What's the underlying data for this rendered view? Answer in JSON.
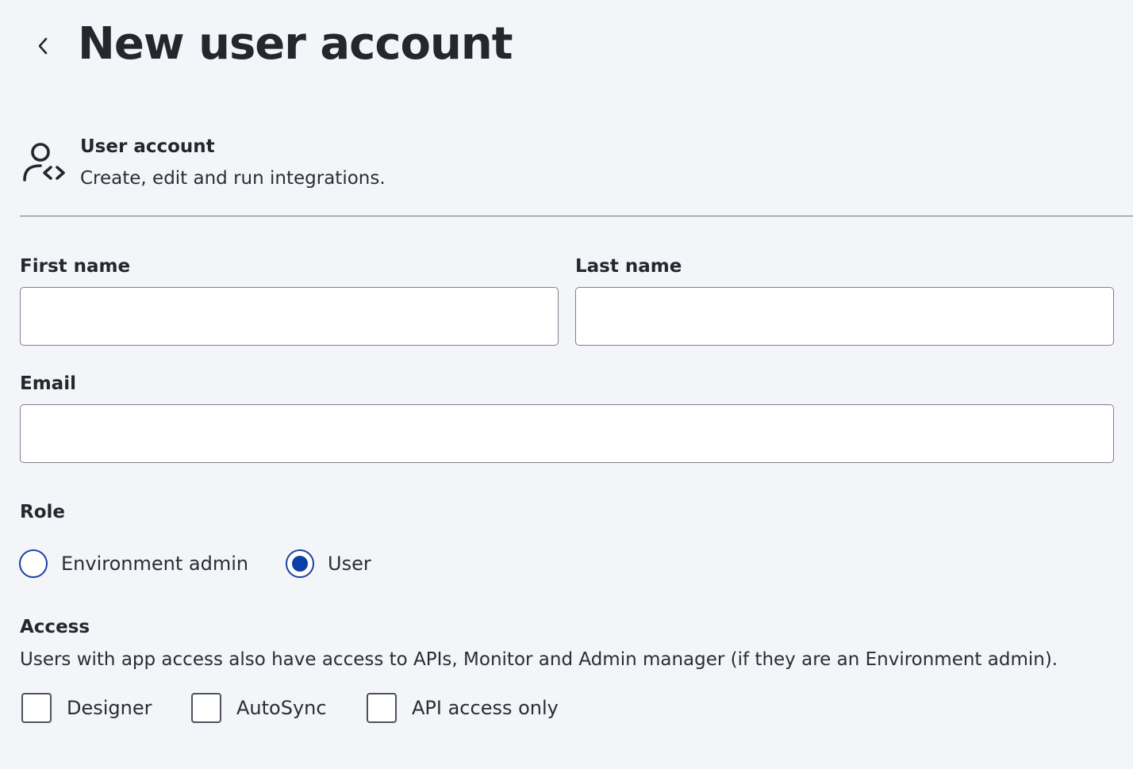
{
  "header": {
    "title": "New user account",
    "back_icon": "chevron-left-icon"
  },
  "account_type": {
    "icon": "user-code-icon",
    "title": "User account",
    "description": "Create, edit and run integrations."
  },
  "form": {
    "first_name": {
      "label": "First name",
      "value": "",
      "placeholder": ""
    },
    "last_name": {
      "label": "Last name",
      "value": "",
      "placeholder": ""
    },
    "email": {
      "label": "Email",
      "value": "",
      "placeholder": ""
    },
    "role": {
      "label": "Role",
      "options": [
        {
          "label": "Environment admin",
          "selected": false
        },
        {
          "label": "User",
          "selected": true
        }
      ]
    },
    "access": {
      "label": "Access",
      "description": "Users with app access also have access to APIs, Monitor and Admin manager (if they are an Environment admin).",
      "options": [
        {
          "label": "Designer",
          "checked": false
        },
        {
          "label": "AutoSync",
          "checked": false
        },
        {
          "label": "API access only",
          "checked": false
        }
      ]
    }
  },
  "colors": {
    "background": "#f4f5f9",
    "accent": "#0f3ea8",
    "text": "#24272e",
    "border": "#7d818c"
  }
}
